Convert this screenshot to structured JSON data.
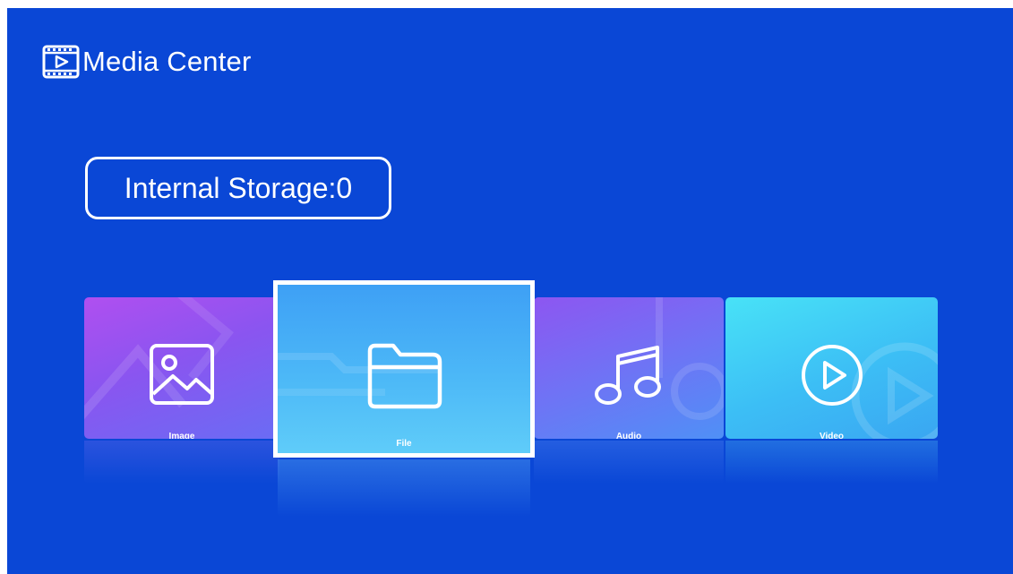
{
  "header": {
    "title": "Media Center",
    "icon": "video-player-icon"
  },
  "storage": {
    "label": "Internal Storage:0"
  },
  "tiles": [
    {
      "id": "image",
      "label": "Image",
      "icon": "image-icon"
    },
    {
      "id": "file",
      "label": "File",
      "icon": "folder-icon",
      "selected": true
    },
    {
      "id": "audio",
      "label": "Audio",
      "icon": "music-note-icon"
    },
    {
      "id": "video",
      "label": "Video",
      "icon": "play-circle-icon"
    }
  ],
  "colors": {
    "background": "#0a47d6",
    "image_tile": "#a052f0",
    "file_tile": "#46b0f6",
    "audio_tile": "#6f73f5",
    "video_tile": "#42cbf6",
    "selection_border": "#ffffff"
  }
}
